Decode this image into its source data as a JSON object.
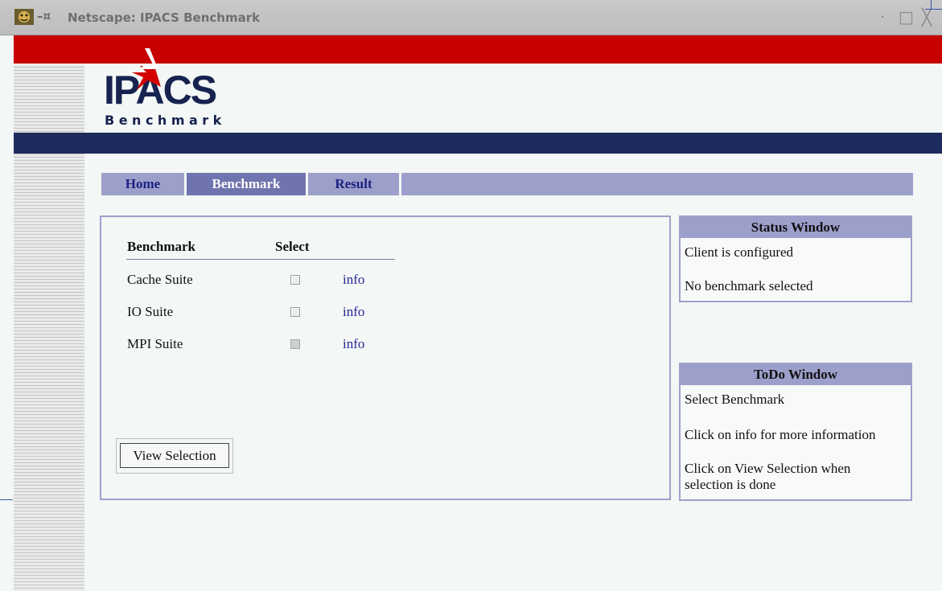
{
  "window": {
    "title": "Netscape: IPACS Benchmark",
    "pin": "–¤",
    "minimize": "·",
    "maximize": "□",
    "close": "╳"
  },
  "logo": {
    "main": "IPACS",
    "sub": "Benchmark"
  },
  "nav": {
    "tabs": [
      "Home",
      "Benchmark",
      "Result"
    ],
    "active": "Benchmark"
  },
  "table": {
    "headers": [
      "Benchmark",
      "Select"
    ],
    "rows": [
      {
        "name": "Cache Suite",
        "checked": false,
        "enabled": true,
        "link": "info"
      },
      {
        "name": "IO Suite",
        "checked": false,
        "enabled": true,
        "link": "info"
      },
      {
        "name": "MPI Suite",
        "checked": false,
        "enabled": false,
        "link": "info"
      }
    ]
  },
  "view_button": "View Selection",
  "status_window": {
    "title": "Status Window",
    "lines": [
      "Client is configured",
      "No benchmark selected"
    ]
  },
  "todo_window": {
    "title": "ToDo Window",
    "lines": [
      "Select Benchmark",
      "Click on info for more information",
      "Click on View Selection when",
      "selection is done"
    ]
  },
  "colors": {
    "red_band": "#c70000",
    "navy_band": "#1e2b5e",
    "nav_bg": "#9d9fcb",
    "nav_active": "#6f74ae",
    "link": "#28289a"
  }
}
